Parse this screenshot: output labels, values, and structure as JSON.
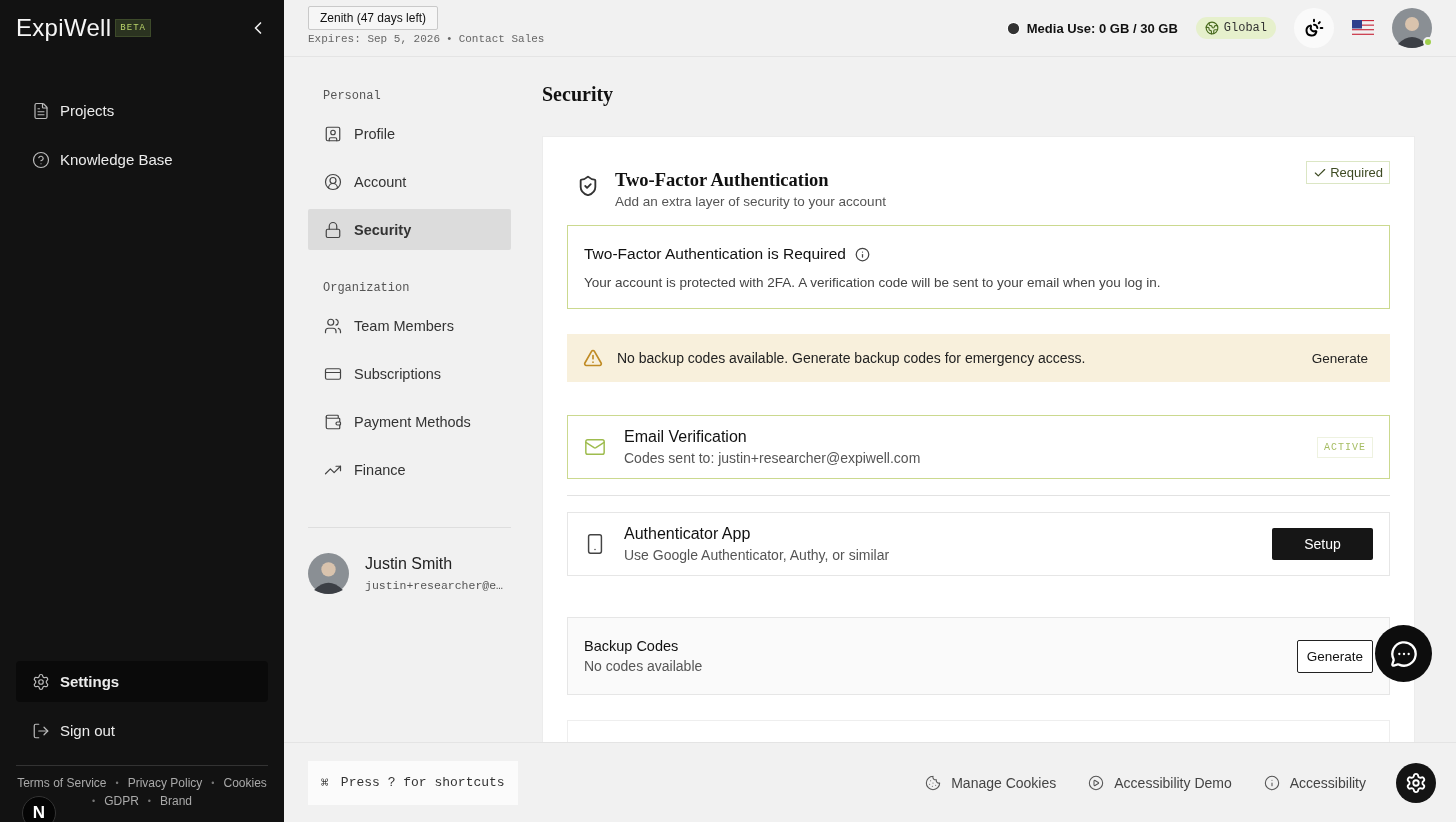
{
  "sidebar": {
    "logo": "ExpiWell",
    "logo_badge": "BETA",
    "nav": [
      {
        "label": "Projects",
        "selected": false
      },
      {
        "label": "Knowledge Base",
        "selected": false
      }
    ],
    "bottom_nav": [
      {
        "label": "Settings",
        "selected": true
      },
      {
        "label": "Sign out",
        "selected": false
      }
    ],
    "footer_links": [
      "Terms of Service",
      "Privacy Policy",
      "Cookies",
      "GDPR",
      "Brand"
    ],
    "separator": "•",
    "corner_badge": "N"
  },
  "header": {
    "plan": "Zenith (47 days left)",
    "expires": "Expires: Sep 5, 2026",
    "separator": "•",
    "contact": "Contact Sales",
    "media": "Media Use: 0 GB / 30 GB",
    "region": "Global",
    "online": true
  },
  "settings_nav": {
    "groups": [
      {
        "title": "Personal",
        "items": [
          {
            "label": "Profile",
            "selected": false
          },
          {
            "label": "Account",
            "selected": false
          },
          {
            "label": "Security",
            "selected": true
          }
        ]
      },
      {
        "title": "Organization",
        "items": [
          {
            "label": "Team Members",
            "selected": false
          },
          {
            "label": "Subscriptions",
            "selected": false
          },
          {
            "label": "Payment Methods",
            "selected": false
          },
          {
            "label": "Finance",
            "selected": false
          }
        ]
      }
    ],
    "user": {
      "name": "Justin Smith",
      "email": "justin+researcher@e…"
    }
  },
  "security": {
    "title": "Security",
    "two_factor": {
      "title": "Two-Factor Authentication",
      "subtitle": "Add an extra layer of security to your account",
      "badge": "Required",
      "notice": {
        "title": "Two-Factor Authentication is Required",
        "text": "Your account is protected with 2FA. A verification code will be sent to your email when you log in."
      },
      "warning": {
        "text": "No backup codes available. Generate backup codes for emergency access.",
        "action": "Generate"
      },
      "methods": [
        {
          "kind": "active",
          "title": "Email Verification",
          "subtitle": "Codes sent to: justin+researcher@expiwell.com",
          "status": "ACTIVE"
        },
        {
          "kind": "setup",
          "title": "Authenticator App",
          "subtitle": "Use Google Authenticator, Authy, or similar",
          "action": "Setup"
        }
      ],
      "backup": {
        "title": "Backup Codes",
        "subtitle": "No codes available",
        "action": "Generate"
      }
    }
  },
  "footer": {
    "shortcut_key": "⌘",
    "shortcuts": "Press ? for shortcuts",
    "links": [
      "Manage Cookies",
      "Accessibility Demo",
      "Accessibility"
    ]
  }
}
